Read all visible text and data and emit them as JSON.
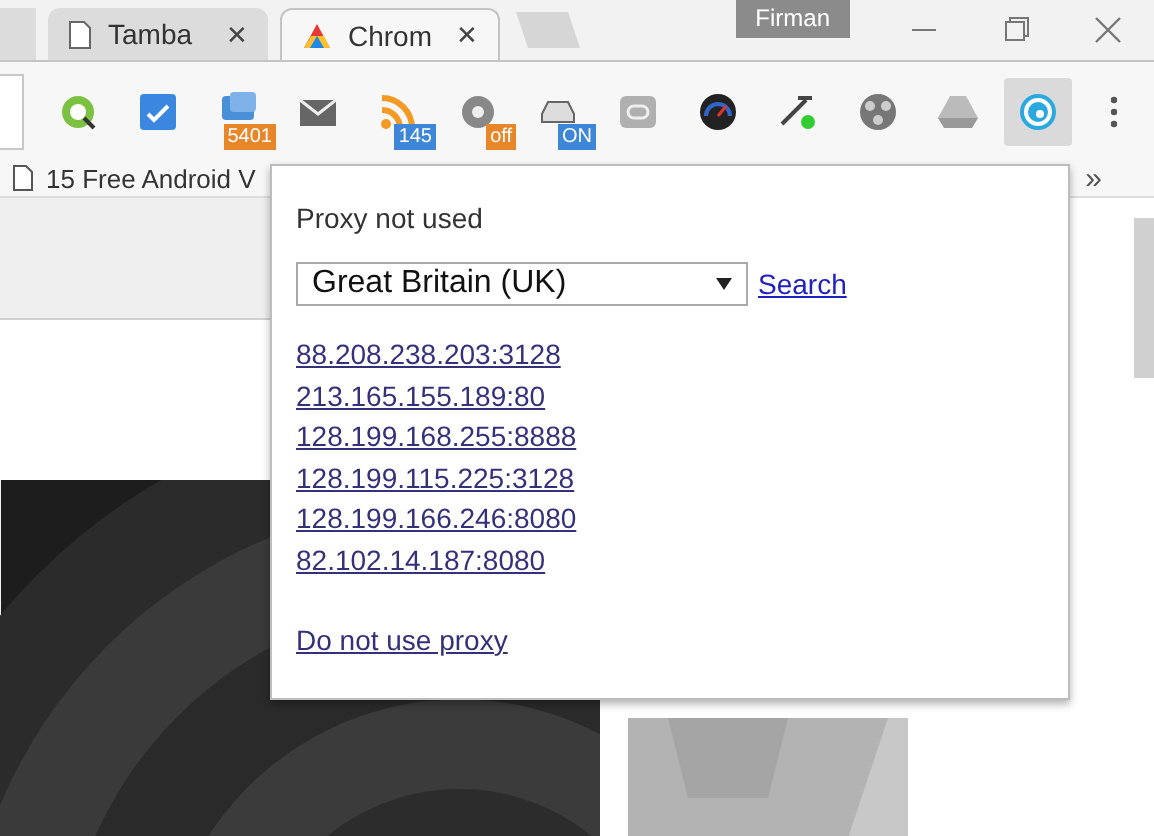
{
  "tabs": [
    {
      "title": "Tamba",
      "selected": false,
      "close": "✕"
    },
    {
      "title": "Chrom",
      "selected": true,
      "close": "✕"
    }
  ],
  "profile": {
    "name": "Firman"
  },
  "extensions": [
    {
      "selected": false
    },
    {
      "selected": false
    },
    {
      "selected": false,
      "badge": "5401",
      "color": "#e8862a"
    },
    {
      "selected": false
    },
    {
      "selected": false,
      "badge": "145",
      "color": "#3d86d8"
    },
    {
      "selected": false,
      "badge": "off",
      "color": "#e8862a"
    },
    {
      "selected": false,
      "badge": "ON",
      "color": "#3d86d8"
    },
    {
      "selected": false
    },
    {
      "selected": false
    },
    {
      "selected": false
    },
    {
      "selected": false
    },
    {
      "selected": false
    },
    {
      "selected": true
    }
  ],
  "bookmarks": {
    "items": [
      "15 Free Android V"
    ],
    "overflow": "»"
  },
  "popup": {
    "status": "Proxy not used",
    "country": "Great Britain (UK)",
    "search": "Search",
    "proxies": [
      "88.208.238.203:3128",
      "213.165.155.189:80",
      "128.199.168.255:8888",
      "128.199.115.225:3128",
      "128.199.166.246:8080",
      "82.102.14.187:8080"
    ],
    "disable": "Do not use proxy"
  }
}
